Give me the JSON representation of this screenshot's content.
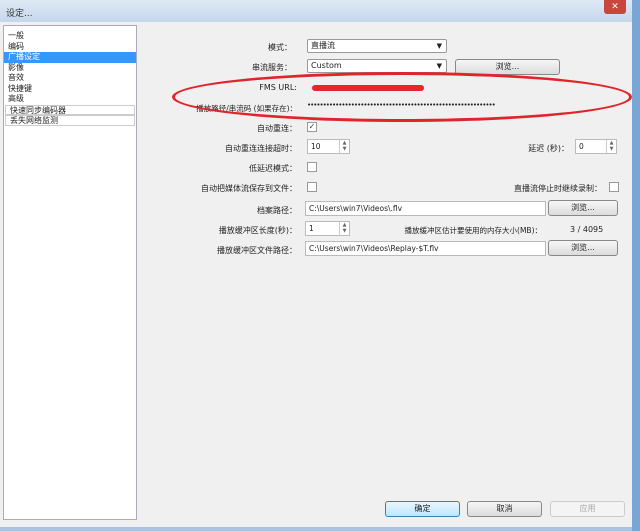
{
  "window": {
    "title": "设定...",
    "close": "✕"
  },
  "sidebar": {
    "items": [
      {
        "label": "一般"
      },
      {
        "label": "编码"
      },
      {
        "label": "广播设定",
        "selected": true
      },
      {
        "label": "影像"
      },
      {
        "label": "音效"
      },
      {
        "label": "快捷键"
      },
      {
        "label": "高级"
      },
      {
        "label": "快速同步编码器"
      },
      {
        "label": "丢失网络监测"
      }
    ]
  },
  "form": {
    "mode_label": "模式：",
    "mode_value": "直播流",
    "service_label": "串流服务：",
    "service_value": "Custom",
    "service_browse": "浏览...",
    "fms_label": "FMS URL:",
    "key_label": "播放路径/串流码 (如果存在)：",
    "key_value": "••••••••••••••••••••••••••••••••••••••••••••••••••••••••••••",
    "autoreconnect_label": "自动重连：",
    "autoreconnect_checked": true,
    "timeout_label": "自动重连连接超时：",
    "timeout_value": "10",
    "delay_label": "延迟 (秒)：",
    "delay_value": "0",
    "lowlatency_label": "低延迟模式：",
    "autosave_label": "自动把媒体流保存到文件：",
    "keeprecord_label": "直播流停止时继续录制：",
    "filepath_label": "档案路径：",
    "filepath_value": "C:\\Users\\win7\\Videos\\.flv",
    "filepath_browse": "浏览...",
    "buffer_label": "播放缓冲区长度(秒)：",
    "buffer_value": "1",
    "memory_label": "播放缓冲区估计要使用的内存大小(MB)：",
    "memory_value": "3 / 4095",
    "replay_label": "播放缓冲区文件路径：",
    "replay_value": "C:\\Users\\win7\\Videos\\Replay-$T.flv",
    "replay_browse": "浏览..."
  },
  "footer": {
    "ok": "确定",
    "cancel": "取消",
    "apply": "应用"
  }
}
